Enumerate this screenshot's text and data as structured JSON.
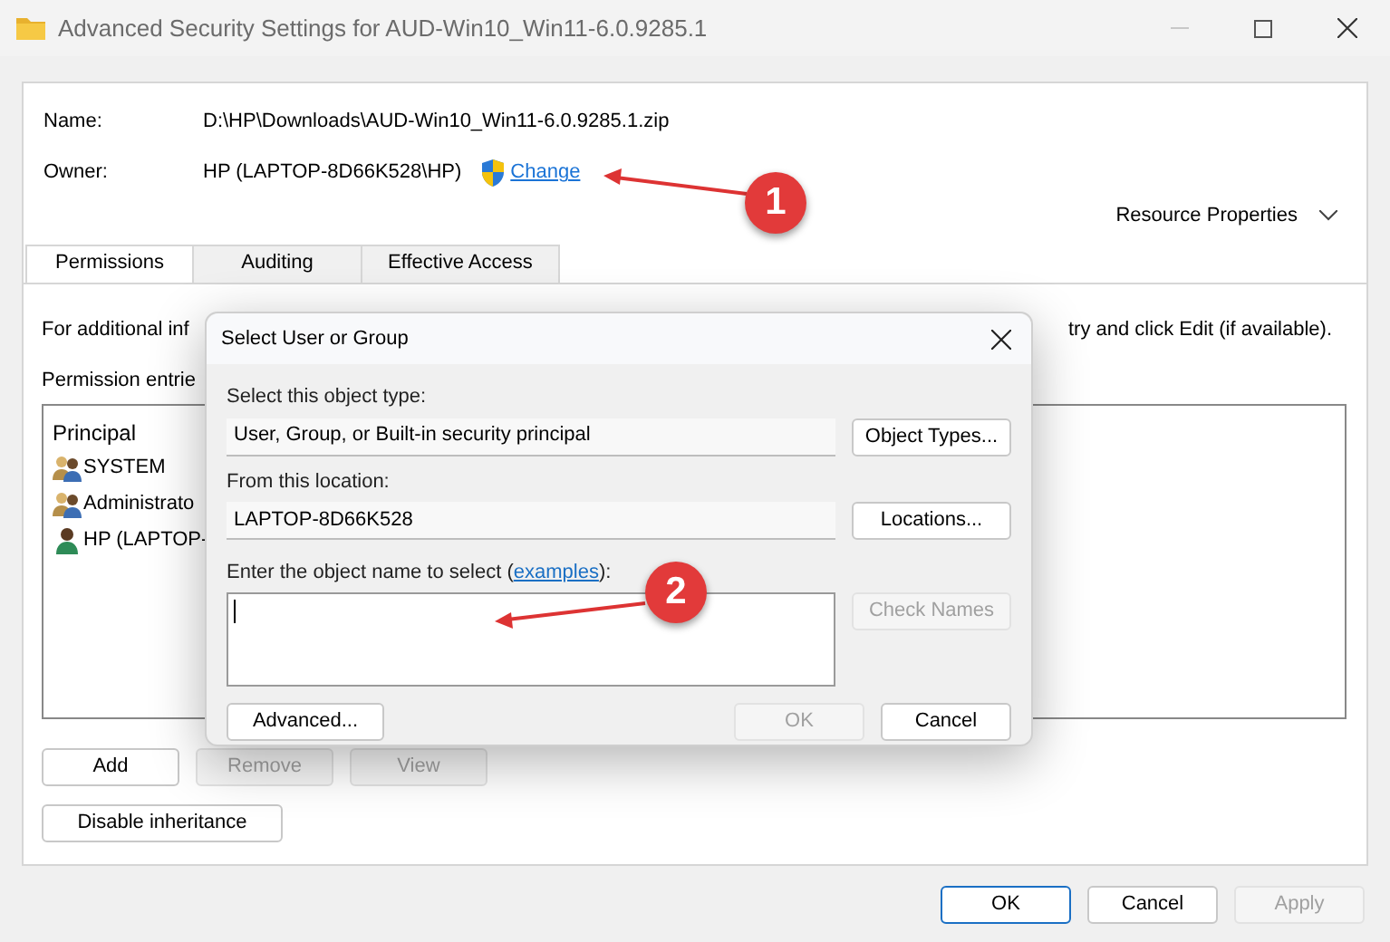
{
  "window": {
    "title": "Advanced Security Settings for AUD-Win10_Win11-6.0.9285.1"
  },
  "fields": [
    {
      "label": "Name:",
      "value": "D:\\HP\\Downloads\\AUD-Win10_Win11-6.0.9285.1.zip"
    },
    {
      "label": "Owner:",
      "value": "HP (LAPTOP-8D66K528\\HP)",
      "link": "Change"
    }
  ],
  "resource_properties": {
    "label": "Resource Properties",
    "expanded": false
  },
  "tabs": [
    {
      "label": "Permissions",
      "selected": true
    },
    {
      "label": "Auditing",
      "selected": false
    },
    {
      "label": "Effective Access",
      "selected": false
    }
  ],
  "info_text_left": "For additional inf",
  "info_text_right": "try and click Edit (if available).",
  "entries_label": "Permission entrie",
  "entries": {
    "column": "Principal",
    "rows": [
      {
        "principal": "SYSTEM",
        "kind": "group"
      },
      {
        "principal": "Administrato",
        "kind": "group"
      },
      {
        "principal": "HP (LAPTOP-",
        "kind": "user"
      }
    ]
  },
  "entry_buttons": [
    {
      "label": "Add",
      "disabled": false
    },
    {
      "label": "Remove",
      "disabled": true
    },
    {
      "label": "View",
      "disabled": true
    }
  ],
  "inheritance_button": "Disable inheritance",
  "footer_buttons": [
    {
      "label": "OK",
      "default": true,
      "disabled": false
    },
    {
      "label": "Cancel",
      "default": false,
      "disabled": false
    },
    {
      "label": "Apply",
      "default": false,
      "disabled": true
    }
  ],
  "dialog": {
    "title": "Select User or Group",
    "type_label": "Select this object type:",
    "type_value": "User, Group, or Built-in security principal",
    "type_button": "Object Types...",
    "location_label": "From this location:",
    "location_value": "LAPTOP-8D66K528",
    "location_button": "Locations...",
    "prompt_start": "Enter the object name to select (",
    "prompt_link": "examples",
    "prompt_end": "):",
    "check_button": {
      "label": "Check Names",
      "disabled": true
    },
    "advanced_button": "Advanced...",
    "buttons": [
      {
        "label": "OK",
        "disabled": true
      },
      {
        "label": "Cancel",
        "disabled": false
      }
    ]
  },
  "annotations": [
    {
      "number": "1"
    },
    {
      "number": "2"
    }
  ]
}
